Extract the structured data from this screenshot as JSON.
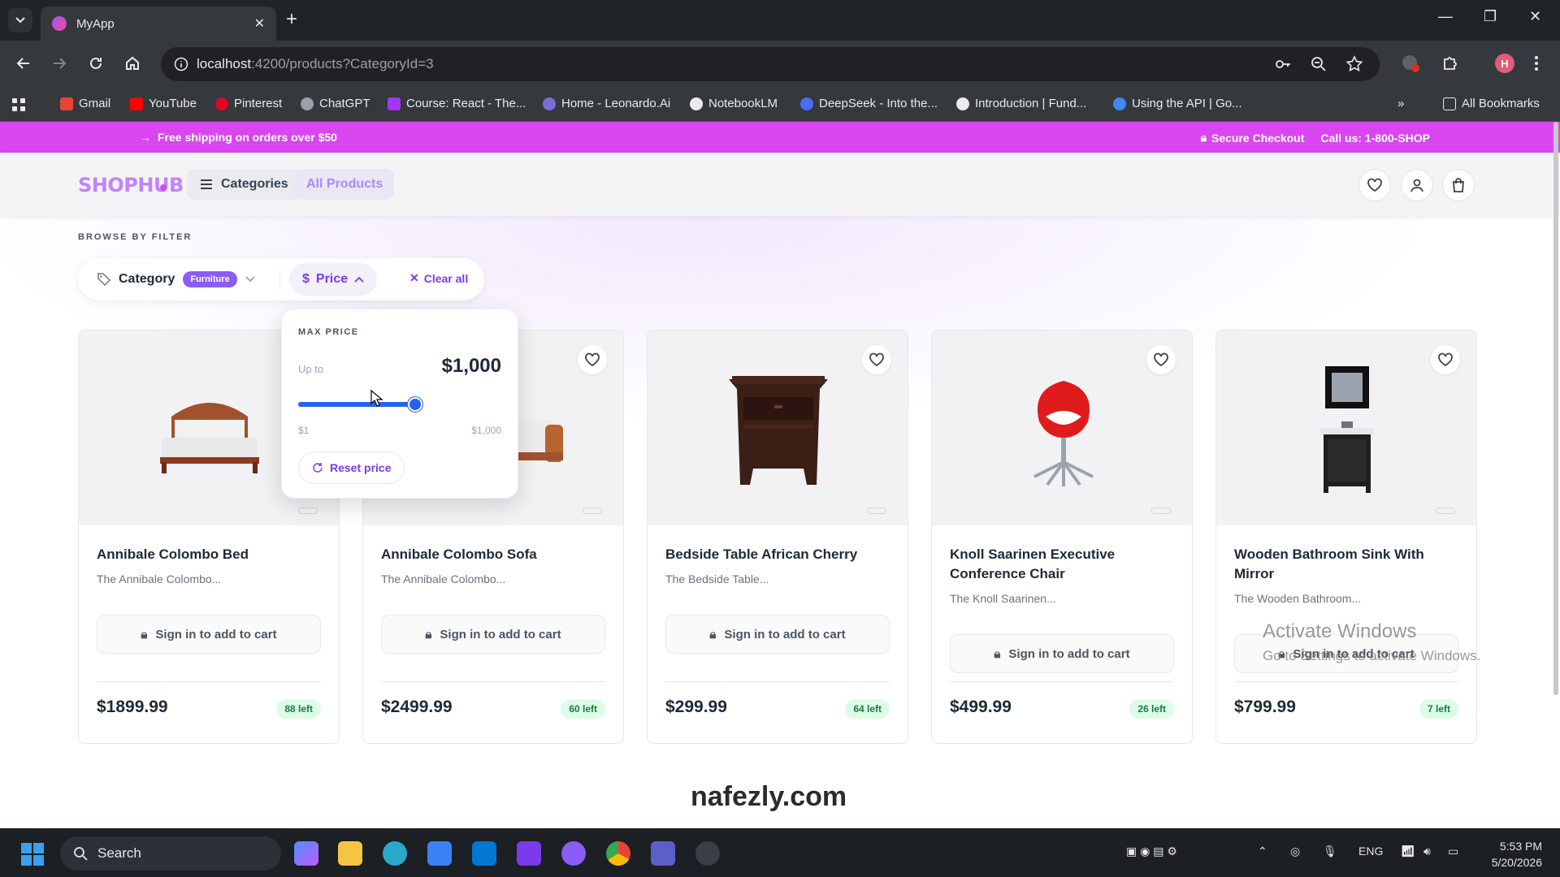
{
  "browser": {
    "tab_title": "MyApp",
    "url_host": "localhost",
    "url_path": ":4200/products?CategoryId=3",
    "bookmarks": [
      "Gmail",
      "YouTube",
      "Pinterest",
      "ChatGPT",
      "Course: React - The...",
      "Home - Leonardo.Ai",
      "NotebookLM",
      "DeepSeek - Into the...",
      "Introduction | Fund...",
      "Using the API | Go..."
    ],
    "all_bookmarks": "All Bookmarks",
    "profile_initial": "H"
  },
  "promo": {
    "left_text": "Free shipping on orders over $50",
    "secure": "Secure Checkout",
    "call": "Call us: 1-800-SHOP"
  },
  "header": {
    "logo": "SHOPHUB",
    "categories_label": "Categories",
    "all_products_label": "All Products"
  },
  "filter": {
    "caption": "BROWSE BY FILTER",
    "category_label": "Category",
    "category_value": "Furniture",
    "price_label": "Price",
    "clear_label": "Clear all"
  },
  "price_popover": {
    "caption": "MAX PRICE",
    "upto_label": "Up to",
    "value": "$1,000",
    "min_label": "$1",
    "max_label": "$1,000",
    "reset_label": "Reset price",
    "slider_fraction": 1.0
  },
  "products": [
    {
      "name": "Annibale Colombo Bed",
      "desc": "The Annibale Colombo...",
      "cart": "Sign in to add to cart",
      "price": "$1899.99",
      "stock": "88 left"
    },
    {
      "name": "Annibale Colombo Sofa",
      "desc": "The Annibale Colombo...",
      "cart": "Sign in to add to cart",
      "price": "$2499.99",
      "stock": "60 left"
    },
    {
      "name": "Bedside Table African Cherry",
      "desc": "The Bedside Table...",
      "cart": "Sign in to add to cart",
      "price": "$299.99",
      "stock": "64 left"
    },
    {
      "name": "Knoll Saarinen Executive Conference Chair",
      "desc": "The Knoll Saarinen...",
      "cart": "Sign in to add to cart",
      "price": "$499.99",
      "stock": "26 left"
    },
    {
      "name": "Wooden Bathroom Sink With Mirror",
      "desc": "The Wooden Bathroom...",
      "cart": "Sign in to add to cart",
      "price": "$799.99",
      "stock": "7 left"
    }
  ],
  "windows_watermark": {
    "line1": "Activate Windows",
    "line2": "Go to Settings to activate Windows."
  },
  "brand_watermark": "nafezly.com",
  "taskbar": {
    "search_label": "Search",
    "lang": "ENG",
    "time": "5:53 PM",
    "date": "5/20/2026"
  }
}
